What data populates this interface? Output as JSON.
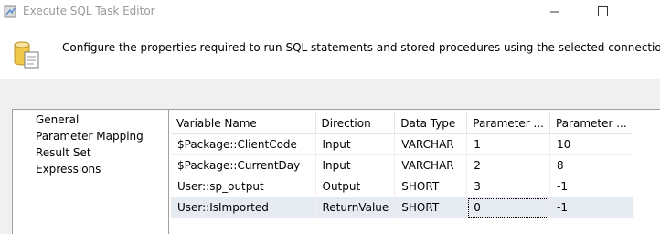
{
  "window": {
    "title": "Execute SQL Task Editor"
  },
  "header": {
    "description": "Configure the properties required to run SQL statements and stored procedures using the selected connection."
  },
  "nav": {
    "items": [
      {
        "label": "General"
      },
      {
        "label": "Parameter Mapping"
      },
      {
        "label": "Result Set"
      },
      {
        "label": "Expressions"
      }
    ],
    "selected": "Parameter Mapping"
  },
  "grid": {
    "columns": [
      "Variable Name",
      "Direction",
      "Data Type",
      "Parameter ...",
      "Parameter ..."
    ],
    "rows": [
      {
        "variable": "$Package::ClientCode",
        "direction": "Input",
        "type": "VARCHAR",
        "name": "1",
        "size": "10"
      },
      {
        "variable": "$Package::CurrentDay",
        "direction": "Input",
        "type": "VARCHAR",
        "name": "2",
        "size": "8"
      },
      {
        "variable": "User::sp_output",
        "direction": "Output",
        "type": "SHORT",
        "name": "3",
        "size": "-1"
      },
      {
        "variable": "User::IsImported",
        "direction": "ReturnValue",
        "type": "SHORT",
        "name": "0",
        "size": "-1"
      }
    ],
    "selected_row": 3
  }
}
